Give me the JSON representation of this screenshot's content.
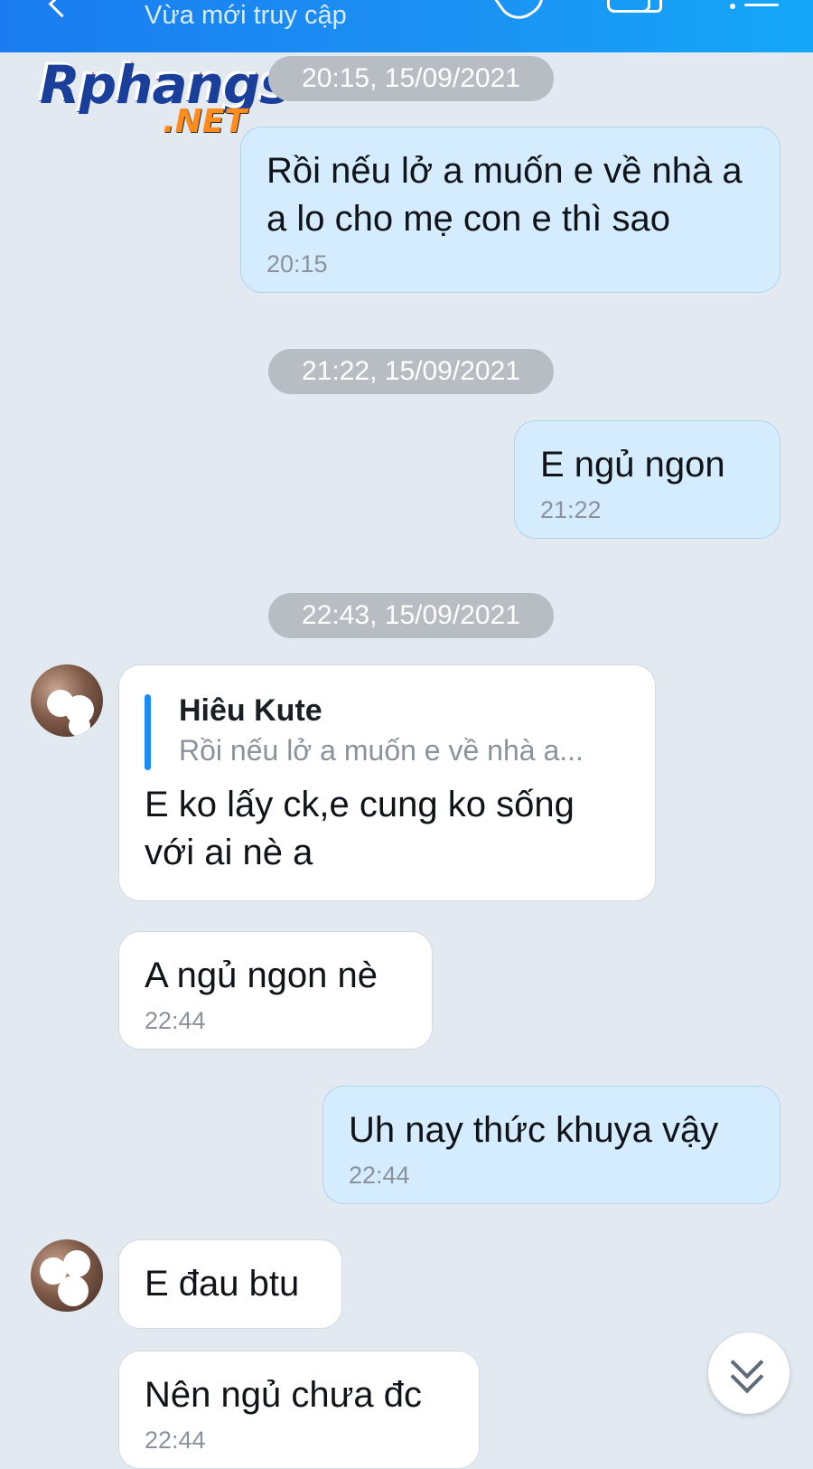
{
  "header": {
    "status": "Vừa mới truy cập",
    "back_icon": "chevron-left-icon",
    "call_icon": "phone-icon",
    "video_icon": "video-camera-icon",
    "menu_icon": "menu-icon"
  },
  "watermark": {
    "word": "Rphangs",
    "suffix": ".NET"
  },
  "messages": {
    "t1": "20:15, 15/09/2021",
    "m1": {
      "text": "Rồi nếu lở a muốn e về nhà a a lo cho mẹ con e thì sao",
      "time": "20:15"
    },
    "t2": "21:22, 15/09/2021",
    "m2": {
      "text": "E ngủ ngon",
      "time": "21:22"
    },
    "t3": "22:43, 15/09/2021",
    "m3": {
      "quote_name": "Hiêu Kute",
      "quote_text": "Rồi nếu lở a muốn e về nhà a...",
      "text": "E ko lấy ck,e cung ko sống với ai nè a"
    },
    "m4": {
      "text": "A ngủ ngon nè",
      "time": "22:44"
    },
    "m5": {
      "text": "Uh nay thức khuya vậy",
      "time": "22:44"
    },
    "m6": {
      "text": "E đau btu"
    },
    "m7": {
      "text": "Nên ngủ chưa đc",
      "time": "22:44"
    }
  },
  "scroll_icon": "double-chevron-down-icon",
  "colors": {
    "header": "#1b8af2",
    "background": "#e2e9f1",
    "my_bubble": "#d4ecfd",
    "their_bubble": "#ffffff",
    "quote_bar": "#1b8cf5"
  }
}
